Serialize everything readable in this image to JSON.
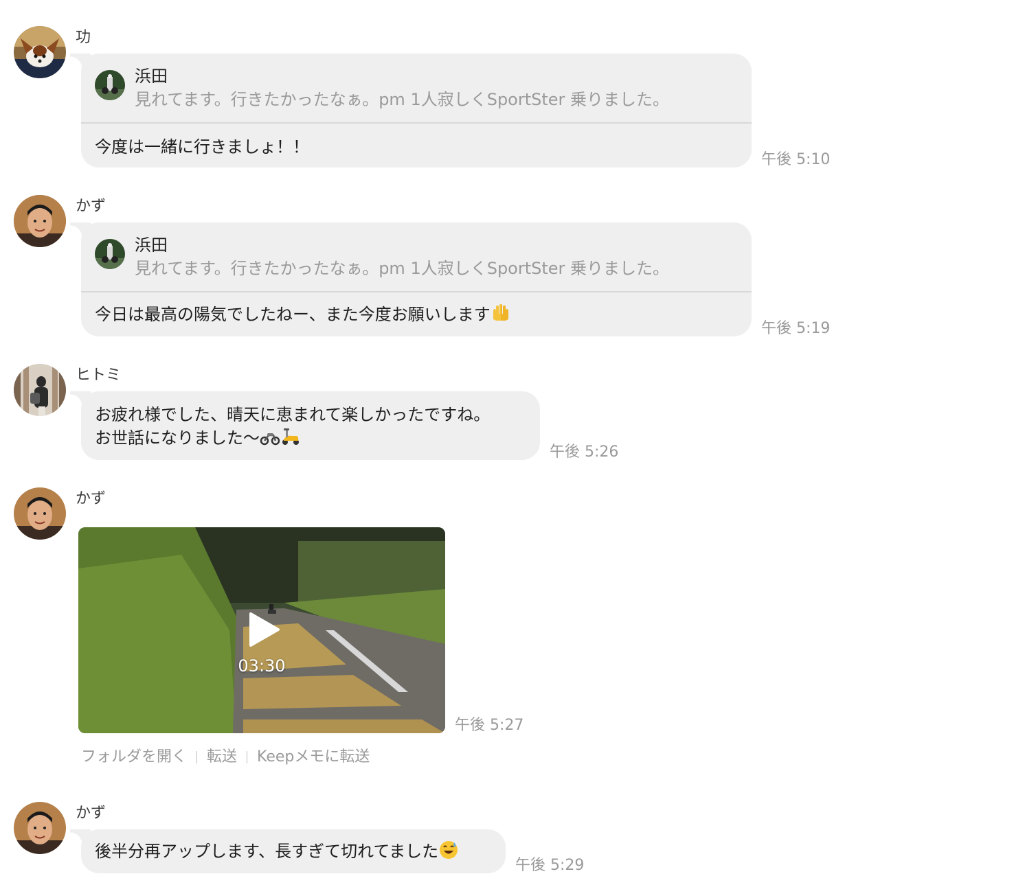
{
  "messages": [
    {
      "sender": "功",
      "reply": {
        "name": "浜田",
        "text": "見れてます。行きたかったなぁ。pm 1人寂しくSportSter 乗りました。"
      },
      "text": "今度は一緒に行きましょ！！",
      "time": "午後 5:10"
    },
    {
      "sender": "かず",
      "reply": {
        "name": "浜田",
        "text": "見れてます。行きたかったなぁ。pm 1人寂しくSportSter 乗りました。"
      },
      "text": "今日は最高の陽気でしたねー、また今度お願いします",
      "time": "午後 5:19"
    },
    {
      "sender": "ヒトミ",
      "line1": "お疲れ様でした、晴天に恵まれて楽しかったですね。",
      "line2": "お世話になりました〜",
      "time": "午後 5:26"
    },
    {
      "sender": "かず",
      "video": {
        "duration": "03:30"
      },
      "time": "午後 5:27",
      "actions": [
        "フォルダを開く",
        "転送",
        "Keepメモに転送"
      ]
    },
    {
      "sender": "かず",
      "text": "後半分再アップします、長すぎて切れてました",
      "time": "午後 5:29"
    }
  ]
}
